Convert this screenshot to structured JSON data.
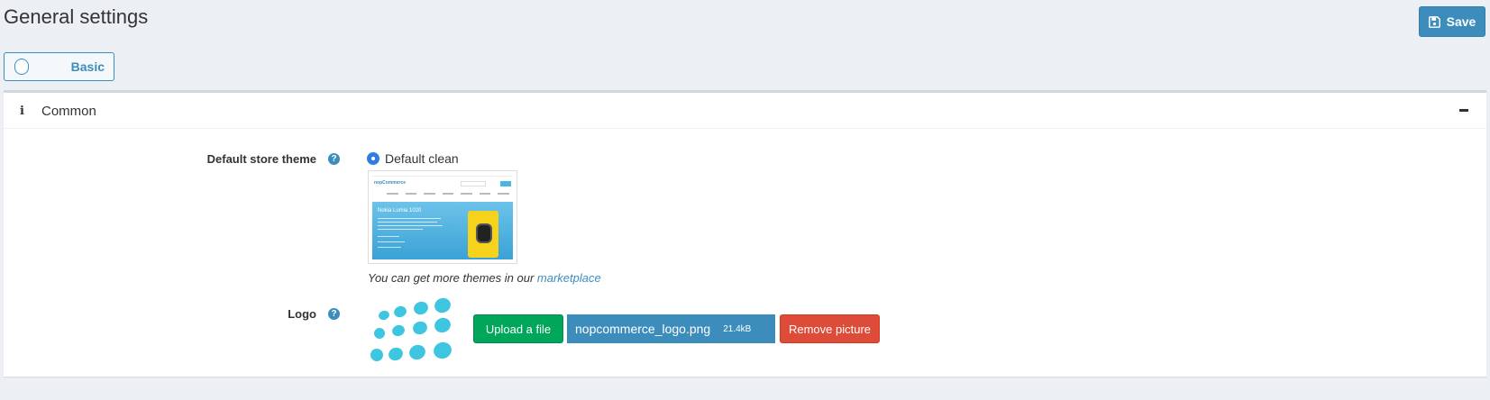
{
  "page": {
    "title": "General settings",
    "save_label": "Save",
    "mode_label": "Basic"
  },
  "card": {
    "title": "Common",
    "theme": {
      "label": "Default store theme",
      "selected_option": "Default clean",
      "preview": {
        "logo_text": "nopCommerce",
        "banner_title": "Nokia Lumia 1020"
      },
      "marketplace_prefix": "You can get more themes in our ",
      "marketplace_link": "marketplace"
    },
    "logo": {
      "label": "Logo",
      "upload_label": "Upload a file",
      "file_name": "nopcommerce_logo.png",
      "file_size": "21.4kB",
      "remove_label": "Remove picture"
    }
  },
  "colors": {
    "primary": "#3c8dbc",
    "success": "#00a65a",
    "danger": "#dd4b39",
    "logo_dots": "#3ec6e0"
  },
  "icons": {
    "save": "floppy-disk-icon",
    "info": "info-icon",
    "collapse": "minus-icon",
    "help": "question-circle-icon"
  }
}
